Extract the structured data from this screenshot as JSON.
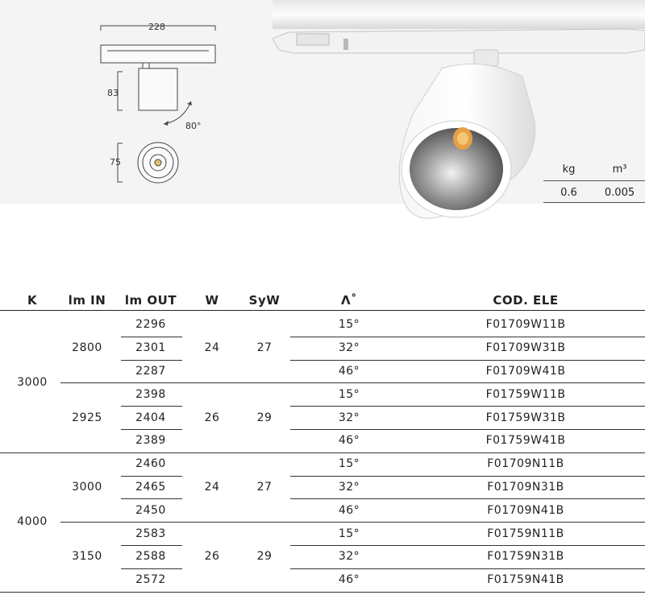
{
  "drawing": {
    "width_mm": "228",
    "height_mm": "83",
    "rotation": "80°",
    "diameter_mm": "75"
  },
  "packaging": {
    "headers": [
      "kg",
      "m³"
    ],
    "values": [
      "0.6",
      "0.005"
    ]
  },
  "spec_table": {
    "headers": [
      "K",
      "lm IN",
      "lm OUT",
      "W",
      "SyW",
      "Λ˚",
      "COD. ELE"
    ],
    "groups": [
      {
        "k": "3000",
        "subgroups": [
          {
            "lm_in": "2800",
            "w": "24",
            "syw": "27",
            "rows": [
              {
                "lm_out": "2296",
                "angle": "15°",
                "code": "F01709W11B"
              },
              {
                "lm_out": "2301",
                "angle": "32°",
                "code": "F01709W31B"
              },
              {
                "lm_out": "2287",
                "angle": "46°",
                "code": "F01709W41B"
              }
            ]
          },
          {
            "lm_in": "2925",
            "w": "26",
            "syw": "29",
            "rows": [
              {
                "lm_out": "2398",
                "angle": "15°",
                "code": "F01759W11B"
              },
              {
                "lm_out": "2404",
                "angle": "32°",
                "code": "F01759W31B"
              },
              {
                "lm_out": "2389",
                "angle": "46°",
                "code": "F01759W41B"
              }
            ]
          }
        ]
      },
      {
        "k": "4000",
        "subgroups": [
          {
            "lm_in": "3000",
            "w": "24",
            "syw": "27",
            "rows": [
              {
                "lm_out": "2460",
                "angle": "15°",
                "code": "F01709N11B"
              },
              {
                "lm_out": "2465",
                "angle": "32°",
                "code": "F01709N31B"
              },
              {
                "lm_out": "2450",
                "angle": "46°",
                "code": "F01709N41B"
              }
            ]
          },
          {
            "lm_in": "3150",
            "w": "26",
            "syw": "29",
            "rows": [
              {
                "lm_out": "2583",
                "angle": "15°",
                "code": "F01759N11B"
              },
              {
                "lm_out": "2588",
                "angle": "32°",
                "code": "F01759N31B"
              },
              {
                "lm_out": "2572",
                "angle": "46°",
                "code": "F01759N41B"
              }
            ]
          }
        ]
      }
    ]
  }
}
